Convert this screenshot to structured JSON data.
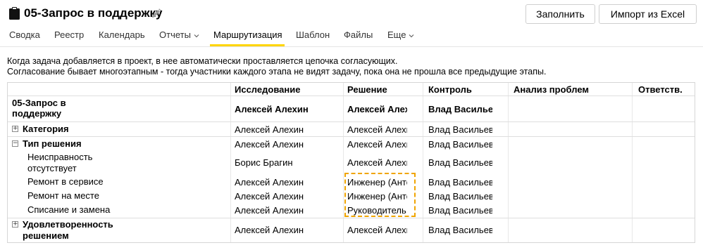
{
  "header": {
    "title": "05-Запрос в поддержку",
    "fill_button": "Заполнить",
    "import_button": "Импорт из Excel"
  },
  "tabs": [
    {
      "label": "Сводка"
    },
    {
      "label": "Реестр"
    },
    {
      "label": "Календарь"
    },
    {
      "label": "Отчеты"
    },
    {
      "label": "Маршрутизация"
    },
    {
      "label": "Шаблон"
    },
    {
      "label": "Файлы"
    },
    {
      "label": "Еще"
    }
  ],
  "description": {
    "line1": "Когда задача добавляется в проект, в нее автоматически проставляется цепочка согласующих.",
    "line2": "Согласование бывает многоэтапным - тогда участники каждого этапа не видят задачу, пока она не прошла все предыдущие этапы."
  },
  "table": {
    "columns": [
      "Исследование",
      "Решение",
      "Контроль",
      "Анализ проблем",
      "Ответств."
    ],
    "project_row": {
      "name": "05-Запрос в поддержку",
      "name_line1": "05-Запрос в",
      "name_line2": "поддержку",
      "cells": [
        "Алексей Алехин",
        "Алексей Алехин",
        "Влад Васильев",
        "",
        ""
      ]
    },
    "rows": [
      {
        "label": "Категория",
        "cells": [
          "Алексей Алехин",
          "Алексей Алехин",
          "Влад Васильев",
          "",
          ""
        ]
      },
      {
        "label": "Тип решения",
        "cells": [
          "Алексей Алехин",
          "Алексей Алехин",
          "Влад Васильев",
          "",
          ""
        ]
      },
      {
        "label_line1": "Неисправность",
        "label_line2": "отсутствует",
        "cells": [
          "Борис Брагин",
          "Алексей Алехин",
          "Влад Васильев",
          "",
          ""
        ]
      },
      {
        "label": "Ремонт в сервисе",
        "cells": [
          "Алексей Алехин",
          "Инженер (Антон)",
          "Влад Васильев",
          "",
          ""
        ]
      },
      {
        "label": "Ремонт на месте",
        "cells": [
          "Алексей Алехин",
          "Инженер (Антон)",
          "Влад Васильев",
          "",
          ""
        ]
      },
      {
        "label": "Списание и замена",
        "cells": [
          "Алексей Алехин",
          "Руководитель",
          "Влад Васильев",
          "",
          ""
        ]
      },
      {
        "label_line1": "Удовлетворенность",
        "label_line2": "решением",
        "cells": [
          "Алексей Алехин",
          "Алексей Алехин",
          "Влад Васильев",
          "",
          ""
        ]
      }
    ]
  },
  "colors": {
    "tab_underline": "#ffd500",
    "highlight": "#f0a500"
  }
}
